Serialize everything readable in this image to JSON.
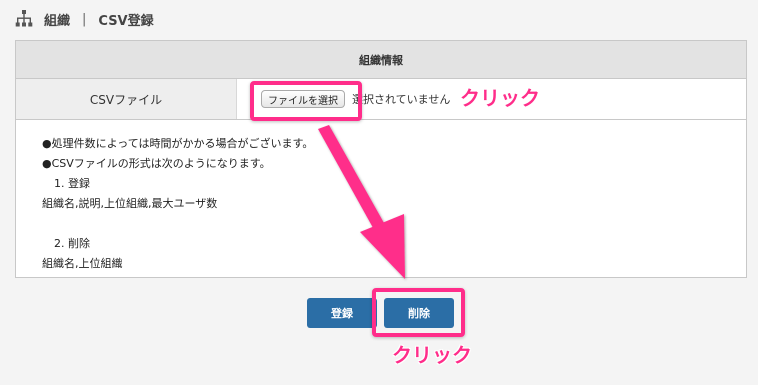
{
  "header": {
    "section": "組織",
    "separator": "|",
    "page": "CSV登録"
  },
  "panel": {
    "title": "組織情報",
    "file_label": "CSVファイル",
    "file_button": "ファイルを選択",
    "file_status": "選択されていません"
  },
  "info": {
    "line1": "●処理件数によっては時間がかかる場合がございます。",
    "line2": "●CSVファイルの形式は次のようになります。",
    "item1_title": "1. 登録",
    "item1_fields": "組織名,説明,上位組織,最大ユーザ数",
    "item2_title": "2. 削除",
    "item2_fields": "組織名,上位組織"
  },
  "buttons": {
    "register": "登録",
    "delete": "削除"
  },
  "annotations": {
    "click_label": "クリック",
    "color": "#ff2d8a"
  },
  "colors": {
    "button_blue": "#2b6ea6",
    "highlight_pink": "#ff2d8a"
  }
}
